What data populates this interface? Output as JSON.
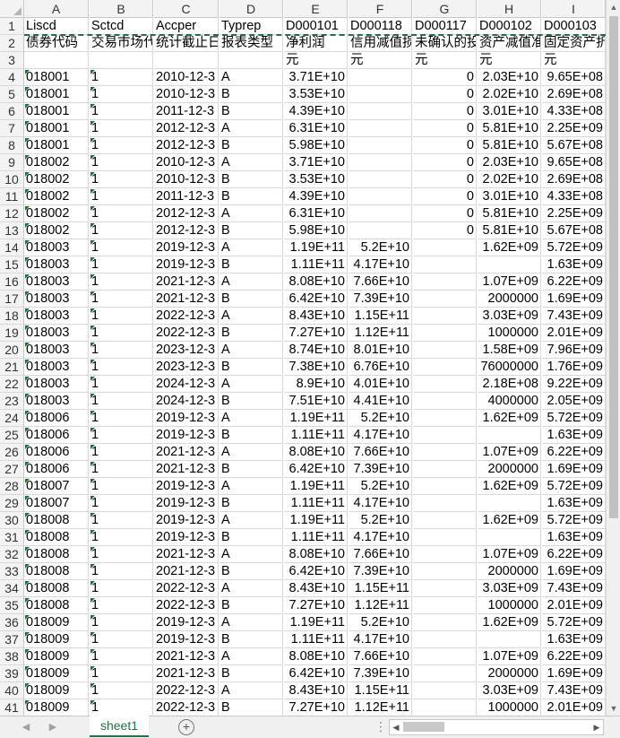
{
  "sheet": {
    "columns": [
      "A",
      "B",
      "C",
      "D",
      "E",
      "F",
      "G",
      "H",
      "I"
    ],
    "row_headers": [
      "1",
      "2",
      "3",
      "4",
      "5",
      "6",
      "7",
      "8",
      "9",
      "10",
      "11",
      "12",
      "13",
      "14",
      "15",
      "16",
      "17",
      "18",
      "19",
      "20",
      "21",
      "22",
      "23",
      "24",
      "25",
      "26",
      "27",
      "28",
      "29",
      "30",
      "31",
      "32",
      "33",
      "34",
      "35",
      "36",
      "37",
      "38",
      "39",
      "40",
      "41"
    ],
    "rows": [
      [
        "Liscd",
        "Sctcd",
        "Accper",
        "Typrep",
        "D000101",
        "D000118",
        "D000117",
        "D000102",
        "D000103"
      ],
      [
        "债券代码",
        "交易市场代",
        "统计截止日",
        "报表类型",
        "净利润",
        "信用减值损",
        "未确认的投",
        "资产减值准",
        "固定资产折"
      ],
      [
        "",
        "",
        "",
        "",
        "元",
        "元",
        "元",
        "元",
        "元"
      ],
      [
        "018001",
        "1",
        "2010-12-3",
        "A",
        "3.71E+10",
        "",
        "0",
        "2.03E+10",
        "9.65E+08"
      ],
      [
        "018001",
        "1",
        "2010-12-3",
        "B",
        "3.53E+10",
        "",
        "0",
        "2.02E+10",
        "2.69E+08"
      ],
      [
        "018001",
        "1",
        "2011-12-3",
        "B",
        "4.39E+10",
        "",
        "0",
        "3.01E+10",
        "4.33E+08"
      ],
      [
        "018001",
        "1",
        "2012-12-3",
        "A",
        "6.31E+10",
        "",
        "0",
        "5.81E+10",
        "2.25E+09"
      ],
      [
        "018001",
        "1",
        "2012-12-3",
        "B",
        "5.98E+10",
        "",
        "0",
        "5.81E+10",
        "5.67E+08"
      ],
      [
        "018002",
        "1",
        "2010-12-3",
        "A",
        "3.71E+10",
        "",
        "0",
        "2.03E+10",
        "9.65E+08"
      ],
      [
        "018002",
        "1",
        "2010-12-3",
        "B",
        "3.53E+10",
        "",
        "0",
        "2.02E+10",
        "2.69E+08"
      ],
      [
        "018002",
        "1",
        "2011-12-3",
        "B",
        "4.39E+10",
        "",
        "0",
        "3.01E+10",
        "4.33E+08"
      ],
      [
        "018002",
        "1",
        "2012-12-3",
        "A",
        "6.31E+10",
        "",
        "0",
        "5.81E+10",
        "2.25E+09"
      ],
      [
        "018002",
        "1",
        "2012-12-3",
        "B",
        "5.98E+10",
        "",
        "0",
        "5.81E+10",
        "5.67E+08"
      ],
      [
        "018003",
        "1",
        "2019-12-3",
        "A",
        "1.19E+11",
        "5.2E+10",
        "",
        "1.62E+09",
        "5.72E+09"
      ],
      [
        "018003",
        "1",
        "2019-12-3",
        "B",
        "1.11E+11",
        "4.17E+10",
        "",
        "",
        "1.63E+09"
      ],
      [
        "018003",
        "1",
        "2021-12-3",
        "A",
        "8.08E+10",
        "7.66E+10",
        "",
        "1.07E+09",
        "6.22E+09"
      ],
      [
        "018003",
        "1",
        "2021-12-3",
        "B",
        "6.42E+10",
        "7.39E+10",
        "",
        "2000000",
        "1.69E+09"
      ],
      [
        "018003",
        "1",
        "2022-12-3",
        "A",
        "8.43E+10",
        "1.15E+11",
        "",
        "3.03E+09",
        "7.43E+09"
      ],
      [
        "018003",
        "1",
        "2022-12-3",
        "B",
        "7.27E+10",
        "1.12E+11",
        "",
        "1000000",
        "2.01E+09"
      ],
      [
        "018003",
        "1",
        "2023-12-3",
        "A",
        "8.74E+10",
        "8.01E+10",
        "",
        "1.58E+09",
        "7.96E+09"
      ],
      [
        "018003",
        "1",
        "2023-12-3",
        "B",
        "7.38E+10",
        "6.76E+10",
        "",
        "76000000",
        "1.76E+09"
      ],
      [
        "018003",
        "1",
        "2024-12-3",
        "A",
        "8.9E+10",
        "4.01E+10",
        "",
        "2.18E+08",
        "9.22E+09"
      ],
      [
        "018003",
        "1",
        "2024-12-3",
        "B",
        "7.51E+10",
        "4.41E+10",
        "",
        "4000000",
        "2.05E+09"
      ],
      [
        "018006",
        "1",
        "2019-12-3",
        "A",
        "1.19E+11",
        "5.2E+10",
        "",
        "1.62E+09",
        "5.72E+09"
      ],
      [
        "018006",
        "1",
        "2019-12-3",
        "B",
        "1.11E+11",
        "4.17E+10",
        "",
        "",
        "1.63E+09"
      ],
      [
        "018006",
        "1",
        "2021-12-3",
        "A",
        "8.08E+10",
        "7.66E+10",
        "",
        "1.07E+09",
        "6.22E+09"
      ],
      [
        "018006",
        "1",
        "2021-12-3",
        "B",
        "6.42E+10",
        "7.39E+10",
        "",
        "2000000",
        "1.69E+09"
      ],
      [
        "018007",
        "1",
        "2019-12-3",
        "A",
        "1.19E+11",
        "5.2E+10",
        "",
        "1.62E+09",
        "5.72E+09"
      ],
      [
        "018007",
        "1",
        "2019-12-3",
        "B",
        "1.11E+11",
        "4.17E+10",
        "",
        "",
        "1.63E+09"
      ],
      [
        "018008",
        "1",
        "2019-12-3",
        "A",
        "1.19E+11",
        "5.2E+10",
        "",
        "1.62E+09",
        "5.72E+09"
      ],
      [
        "018008",
        "1",
        "2019-12-3",
        "B",
        "1.11E+11",
        "4.17E+10",
        "",
        "",
        "1.63E+09"
      ],
      [
        "018008",
        "1",
        "2021-12-3",
        "A",
        "8.08E+10",
        "7.66E+10",
        "",
        "1.07E+09",
        "6.22E+09"
      ],
      [
        "018008",
        "1",
        "2021-12-3",
        "B",
        "6.42E+10",
        "7.39E+10",
        "",
        "2000000",
        "1.69E+09"
      ],
      [
        "018008",
        "1",
        "2022-12-3",
        "A",
        "8.43E+10",
        "1.15E+11",
        "",
        "3.03E+09",
        "7.43E+09"
      ],
      [
        "018008",
        "1",
        "2022-12-3",
        "B",
        "7.27E+10",
        "1.12E+11",
        "",
        "1000000",
        "2.01E+09"
      ],
      [
        "018009",
        "1",
        "2019-12-3",
        "A",
        "1.19E+11",
        "5.2E+10",
        "",
        "1.62E+09",
        "5.72E+09"
      ],
      [
        "018009",
        "1",
        "2019-12-3",
        "B",
        "1.11E+11",
        "4.17E+10",
        "",
        "",
        "1.63E+09"
      ],
      [
        "018009",
        "1",
        "2021-12-3",
        "A",
        "8.08E+10",
        "7.66E+10",
        "",
        "1.07E+09",
        "6.22E+09"
      ],
      [
        "018009",
        "1",
        "2021-12-3",
        "B",
        "6.42E+10",
        "7.39E+10",
        "",
        "2000000",
        "1.69E+09"
      ],
      [
        "018009",
        "1",
        "2022-12-3",
        "A",
        "8.43E+10",
        "1.15E+11",
        "",
        "3.03E+09",
        "7.43E+09"
      ],
      [
        "018009",
        "1",
        "2022-12-3",
        "B",
        "7.27E+10",
        "1.12E+11",
        "",
        "1000000",
        "2.01E+09"
      ]
    ]
  },
  "tabs": {
    "active": "sheet1"
  },
  "icons": {
    "add_sheet": "plus-circle-icon",
    "prev_sheet": "triangle-left-icon",
    "next_sheet": "triangle-right-icon",
    "scroll_up": "arrow-up-icon",
    "scroll_down": "arrow-down-icon",
    "scroll_left": "arrow-left-icon",
    "scroll_right": "arrow-right-icon",
    "more_tabs": "ellipsis-icon"
  },
  "colors": {
    "accent": "#217346",
    "header_bg": "#f3f3f3",
    "gridline": "#d9d9d9",
    "copy_marquee": "#1e7145"
  }
}
